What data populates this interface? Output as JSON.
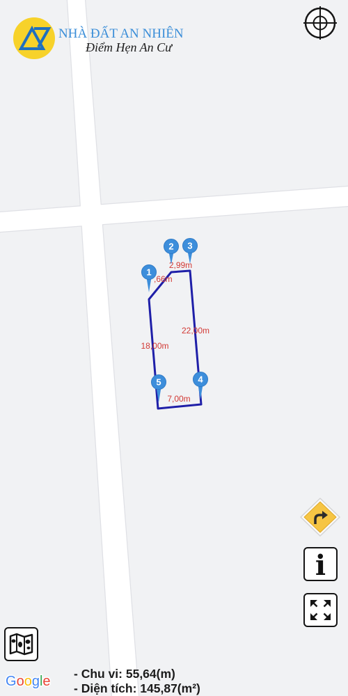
{
  "brand": {
    "name": "NHÀ ĐẤT AN NHIÊN",
    "slogan": "Điểm Hẹn An Cư",
    "logo_icon": "brand-logo-icon"
  },
  "map": {
    "parcel": {
      "vertex_labels": [
        "1",
        "2",
        "3",
        "4",
        "5"
      ],
      "edge_lengths": {
        "edge_1_2": ",66m",
        "edge_2_3": "2,99m",
        "edge_3_4": "22,00m",
        "edge_4_5": "7,00m",
        "edge_5_1": "18,00m"
      }
    },
    "attribution_letters": [
      "G",
      "o",
      "o",
      "g",
      "l",
      "e"
    ]
  },
  "controls": {
    "locate_button": {
      "icon": "crosshair-icon"
    },
    "directions_button": {
      "icon": "turn-right-icon"
    },
    "info_button": {
      "label": "i",
      "icon": "info-icon"
    },
    "fullscreen_button": {
      "icon": "expand-icon"
    },
    "layers_button": {
      "icon": "map-layers-icon"
    }
  },
  "summary": {
    "perimeter": "- Chu vi: 55,64(m)",
    "area": "- Diện tích: 145,87(m²)"
  },
  "colors": {
    "map_background": "#f1f2f4",
    "road": "#ffffff",
    "road_edge": "#dfe0e5",
    "parcel_outline": "#1f1fa8",
    "marker": "#3d8edb",
    "edge_label": "#d23a35",
    "brand_blue": "#3b8ed8",
    "logo_yellow": "#f7d22a",
    "logo_blue": "#1f6fbf",
    "directions_yellow": "#f6c544"
  }
}
